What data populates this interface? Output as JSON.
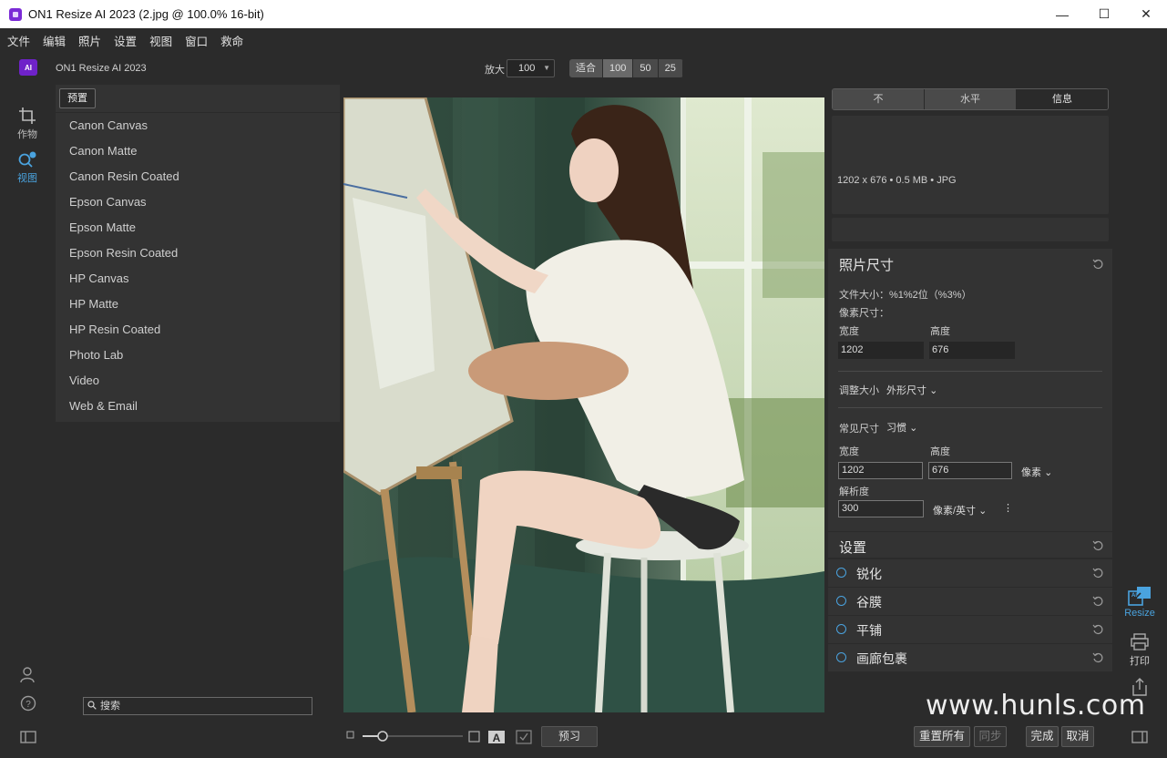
{
  "window": {
    "title": "ON1 Resize AI 2023 (2.jpg @ 100.0% 16-bit)",
    "controls": [
      "—",
      "☐",
      "✕"
    ]
  },
  "menu": [
    "文件",
    "编辑",
    "照片",
    "设置",
    "视图",
    "窗口",
    "救命"
  ],
  "toolbar": {
    "logo_text": "AI",
    "app_name": "ON1 Resize AI 2023",
    "zoom_label": "放大",
    "zoom_value": "100",
    "zoom_buttons": [
      "适合",
      "100",
      "50",
      "25"
    ],
    "active_zoom": "100"
  },
  "left_rail": {
    "tools": [
      {
        "label": "作物",
        "icon": "crop-icon"
      },
      {
        "label": "视图",
        "icon": "view-icon"
      }
    ]
  },
  "presets": {
    "tab_label": "预置",
    "items": [
      "Canon Canvas",
      "Canon Matte",
      "Canon Resin Coated",
      "Epson Canvas",
      "Epson Matte",
      "Epson Resin Coated",
      "HP Canvas",
      "HP Matte",
      "HP Resin Coated",
      "Photo Lab",
      "Video",
      "Web & Email"
    ]
  },
  "search": {
    "value": "搜索"
  },
  "right_panel": {
    "tabs": [
      "不",
      "水平",
      "信息"
    ],
    "info_text": "1202 x 676 • 0.5 MB • JPG",
    "photo_size": {
      "title": "照片尺寸",
      "file_size_label": "文件大小：%1%2位（%3%）",
      "pixel_size_label": "像素尺寸：",
      "width_label": "宽度",
      "height_label": "高度",
      "width": "1202",
      "height": "676",
      "resize_label": "调整大小",
      "resize_mode": "外形尺寸",
      "common_size_label": "常见尺寸",
      "common_size_value": "习惯",
      "width2_label": "宽度",
      "height2_label": "高度",
      "width2": "1202",
      "height2": "676",
      "unit": "像素",
      "resolution_label": "解析度",
      "resolution": "300",
      "resolution_unit": "像素/英寸"
    },
    "settings_title": "设置",
    "effects": [
      "锐化",
      "谷膜",
      "平铺",
      "画廊包裹"
    ]
  },
  "right_rail": {
    "tools": [
      {
        "label": "Resize",
        "icon": "ai-resize-icon",
        "active": true
      },
      {
        "label": "打印",
        "icon": "print-icon",
        "active": false
      },
      {
        "label": "",
        "icon": "export-icon",
        "active": false
      }
    ]
  },
  "bottom": {
    "preview_label": "预习",
    "reset_all_label": "重置所有",
    "sync_label": "同步",
    "done_label": "完成",
    "cancel_label": "取消"
  },
  "watermark": "www.hunls.com",
  "colors": {
    "accent": "#4aa3df",
    "brand": "#6f22c9",
    "panel": "#333333",
    "background": "#2b2b2b"
  }
}
